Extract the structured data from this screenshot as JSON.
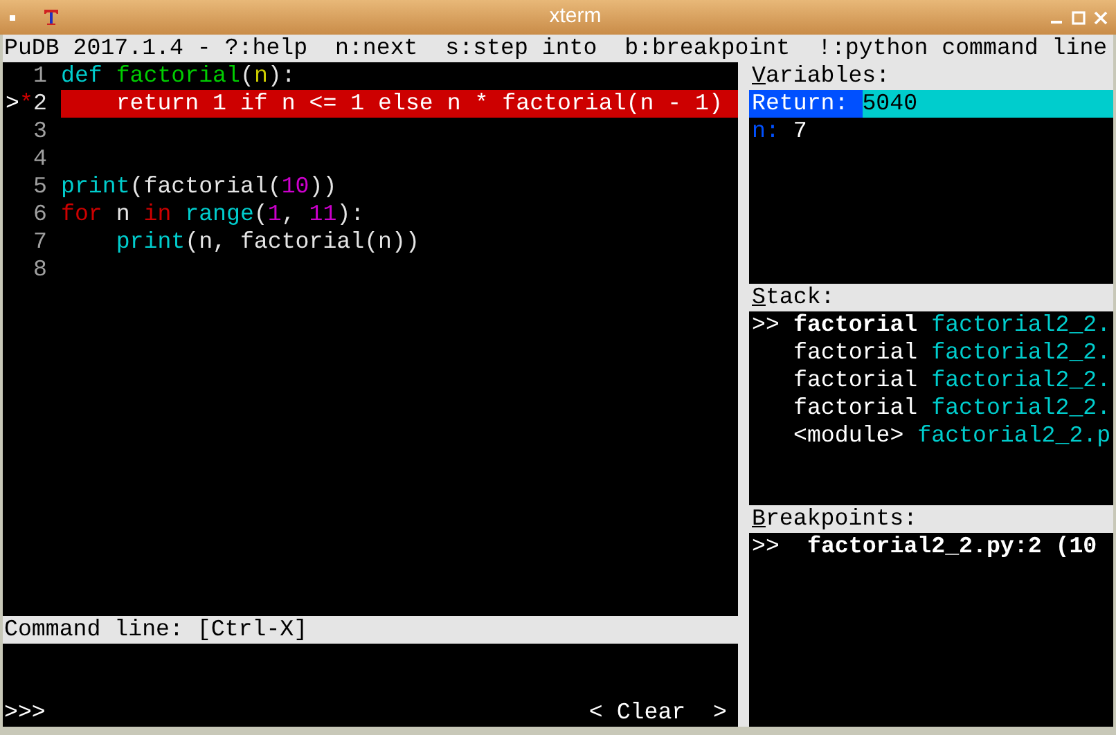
{
  "window": {
    "title": "xterm"
  },
  "header_bar": "PuDB 2017.1.4 - ?:help  n:next  s:step into  b:breakpoint  !:python command line",
  "source": {
    "lines": [
      {
        "number": "1",
        "current": false,
        "breakpoint": false,
        "tokens": [
          {
            "text": "def",
            "kind": "keyword"
          },
          {
            "text": " factorial",
            "kind": "name"
          },
          {
            "text": "(",
            "kind": "plain"
          },
          {
            "text": "n",
            "kind": "param"
          },
          {
            "text": "):",
            "kind": "plain"
          }
        ]
      },
      {
        "number": "2",
        "current": true,
        "marker": ">",
        "breakpoint": true,
        "bp_mark": "*",
        "tokens": [
          {
            "text": "    return 1 if n <= 1 else n * factorial(n - 1)",
            "kind": "plain"
          }
        ]
      },
      {
        "number": "3",
        "current": false,
        "breakpoint": false
      },
      {
        "number": "4",
        "current": false,
        "breakpoint": false
      },
      {
        "number": "5",
        "current": false,
        "breakpoint": false,
        "tokens": [
          {
            "text": "print",
            "kind": "builtin"
          },
          {
            "text": "(factorial(",
            "kind": "plain"
          },
          {
            "text": "10",
            "kind": "number"
          },
          {
            "text": "))",
            "kind": "plain"
          }
        ]
      },
      {
        "number": "6",
        "current": false,
        "breakpoint": false,
        "tokens": [
          {
            "text": "for",
            "kind": "control"
          },
          {
            "text": " n ",
            "kind": "plain"
          },
          {
            "text": "in",
            "kind": "control"
          },
          {
            "text": " range",
            "kind": "builtin"
          },
          {
            "text": "(",
            "kind": "plain"
          },
          {
            "text": "1",
            "kind": "number"
          },
          {
            "text": ", ",
            "kind": "plain"
          },
          {
            "text": "11",
            "kind": "number"
          },
          {
            "text": "):",
            "kind": "plain"
          }
        ]
      },
      {
        "number": "7",
        "current": false,
        "breakpoint": false,
        "tokens": [
          {
            "text": "    print",
            "kind": "builtin"
          },
          {
            "text": "(n, factorial(n))",
            "kind": "plain"
          }
        ]
      },
      {
        "number": "8",
        "current": false,
        "breakpoint": false
      }
    ]
  },
  "command_line": {
    "title": "Command line: [Ctrl-X]",
    "prompt": ">>>",
    "clear_button": "< Clear  >"
  },
  "variables": {
    "title": "Variables:",
    "items": [
      {
        "name": "Return:",
        "value": "5040",
        "selected": true
      },
      {
        "name": "n:",
        "value": "7",
        "selected": false
      }
    ]
  },
  "stack": {
    "title": "Stack:",
    "items": [
      {
        "marker": ">>",
        "function": "factorial",
        "file": "factorial2_2.",
        "current": true
      },
      {
        "function": "factorial",
        "file": "factorial2_2.",
        "current": false
      },
      {
        "function": "factorial",
        "file": "factorial2_2.",
        "current": false
      },
      {
        "function": "factorial",
        "file": "factorial2_2.",
        "current": false
      },
      {
        "function": "<module>",
        "file": "factorial2_2.p",
        "current": false
      }
    ]
  },
  "breakpoints": {
    "title": "Breakpoints:",
    "items": [
      {
        "marker": ">>",
        "text": "factorial2_2.py:2 (10"
      }
    ]
  }
}
